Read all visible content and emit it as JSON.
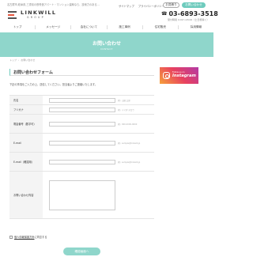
{
  "header": {
    "tagline": "名古屋市,岐阜県,三重県の鉄骨造アパート・マンション建築なら、技術力のある…",
    "logo_name": "LINKWILL",
    "logo_sub": "GROUP",
    "links": [
      "サイトマップ",
      "プライバシーポリシー"
    ],
    "login_label": "お見積り",
    "contact_label": "お問い合わせ",
    "phone": "03-6893-3518",
    "hours": "受付時間 9:00〜18:00（土日祝除く）"
  },
  "nav": {
    "items": [
      "トップ",
      "メッセージ",
      "会社について",
      "施工事例",
      "住宅販売",
      "採用情報"
    ]
  },
  "hero": {
    "title": "お問い合わせ",
    "subtitle": "CONTACT"
  },
  "breadcrumb": {
    "home": "トップ",
    "separator": "›",
    "current": "お問い合わせ"
  },
  "form": {
    "section_title": "お問い合わせフォーム",
    "intro": "下記の事項をご入力の上、送信してください。担当者よりご連絡いたします。",
    "fields": [
      {
        "label": "氏名",
        "hint": "例）山田 太郎"
      },
      {
        "label": "フリガナ",
        "hint": "例）ヤマダ タロウ"
      },
      {
        "label": "電話番号（数字可）",
        "hint": "例）000-0000-0000"
      },
      {
        "label": "E-mail",
        "hint": "例）sample@linkwill.jp"
      },
      {
        "label": "E-mail（確認用）",
        "hint": "例）sample@linkwill.jp"
      },
      {
        "label": "お問い合わせ内容",
        "hint": ""
      }
    ],
    "privacy_text_link": "個人情報保護方針",
    "privacy_text_rest": "に同意する",
    "submit_label": "確認画面へ"
  },
  "sidebar": {
    "insta_small": "Follow us on",
    "insta_big": "Instagram"
  },
  "colors": {
    "accent": "#6ecbbd",
    "hero": "#8fd6cb",
    "brand_red": "#e8553d"
  }
}
